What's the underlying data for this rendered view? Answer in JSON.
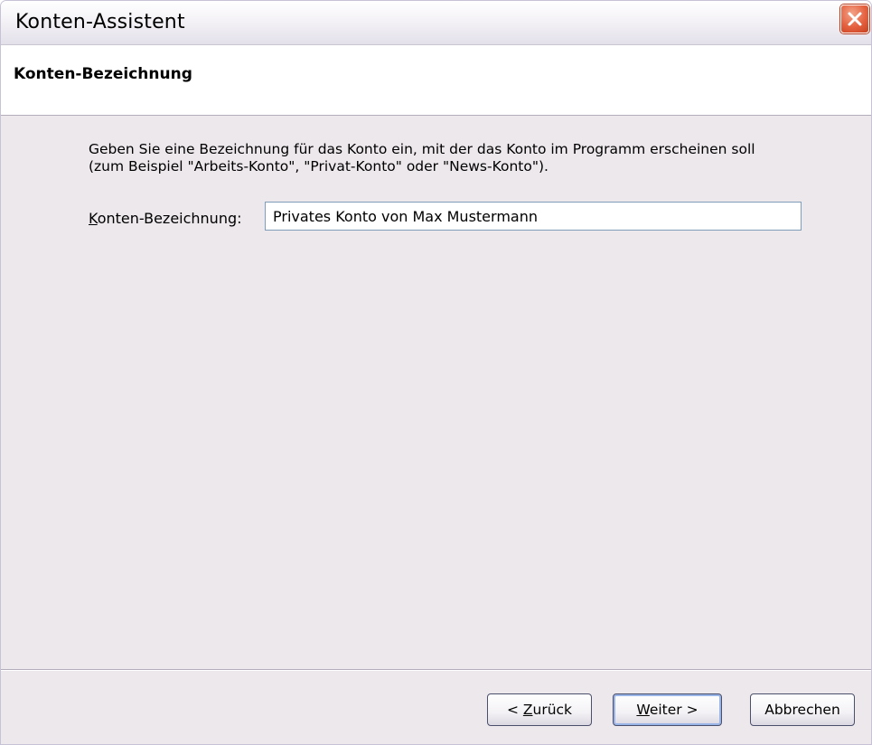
{
  "window": {
    "title": "Konten-Assistent",
    "close_icon": "close-icon"
  },
  "header": {
    "title": "Konten-Bezeichnung"
  },
  "content": {
    "description_line1": "Geben Sie eine Bezeichnung für das Konto ein, mit der das Konto im Programm erscheinen soll",
    "description_line2": "(zum Beispiel \"Arbeits-Konto\", \"Privat-Konto\" oder \"News-Konto\").",
    "field_label_accel": "K",
    "field_label_rest": "onten-Bezeichnung:",
    "field_value": "Privates Konto von Max Mustermann"
  },
  "buttons": {
    "back_prefix": "< ",
    "back_accel": "Z",
    "back_rest": "urück",
    "next_accel": "W",
    "next_rest": "eiter >",
    "cancel": "Abbrechen"
  },
  "colors": {
    "close_button": "#d9532f",
    "content_bg": "#ede8ec",
    "input_border": "#7f9db9"
  }
}
